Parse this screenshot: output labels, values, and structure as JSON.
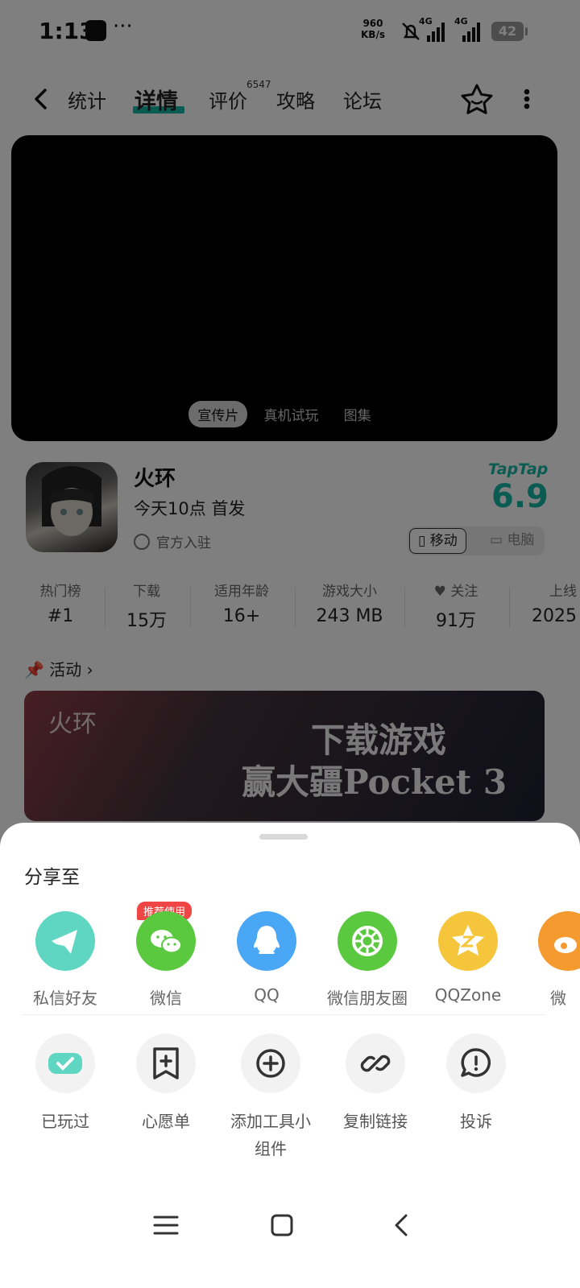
{
  "status_bar": {
    "time": "1:13",
    "dots": "···",
    "net_speed": "960",
    "net_unit": "KB/s",
    "sig1": "4G",
    "sig2": "4G",
    "battery": "42"
  },
  "nav": {
    "tabs": [
      {
        "label": "统计"
      },
      {
        "label": "详情"
      },
      {
        "label": "评价"
      },
      {
        "label": "攻略"
      },
      {
        "label": "论坛"
      }
    ],
    "active_tab": "详情",
    "review_count": "6547"
  },
  "video": {
    "tabs": [
      "宣传片",
      "真机试玩",
      "图集"
    ],
    "active": "宣传片"
  },
  "game": {
    "name": "火环",
    "release": "今天10点 首发",
    "official": "官方入驻",
    "brand": "TapTap",
    "score": "6.9",
    "platforms": {
      "mobile": "移动",
      "pc": "电脑"
    }
  },
  "stats": [
    {
      "label": "热门榜",
      "value": "#1"
    },
    {
      "label": "下载",
      "value": "15万"
    },
    {
      "label": "适用年龄",
      "value": "16+"
    },
    {
      "label": "游戏大小",
      "value": "243 MB"
    },
    {
      "label": "关注",
      "value": "91万"
    },
    {
      "label": "上线",
      "value": "2025"
    }
  ],
  "activity": {
    "title": "活动",
    "banner_line1": "下载游戏",
    "banner_line2": "赢大疆Pocket 3",
    "banner_brand": "火环"
  },
  "share": {
    "title": "分享至",
    "recommend_badge": "推荐使用",
    "targets": [
      {
        "label": "私信好友",
        "color": "#5ed6c2"
      },
      {
        "label": "微信",
        "color": "#5ac940"
      },
      {
        "label": "QQ",
        "color": "#49a7f5"
      },
      {
        "label": "微信朋友圈",
        "color": "#5ac940"
      },
      {
        "label": "QQZone",
        "color": "#f5c63c"
      },
      {
        "label": "微",
        "color": "#f59a2e"
      }
    ],
    "actions": [
      {
        "label": "已玩过"
      },
      {
        "label": "心愿单"
      },
      {
        "label": "添加工具小组件"
      },
      {
        "label": "复制链接"
      },
      {
        "label": "投诉"
      }
    ]
  }
}
